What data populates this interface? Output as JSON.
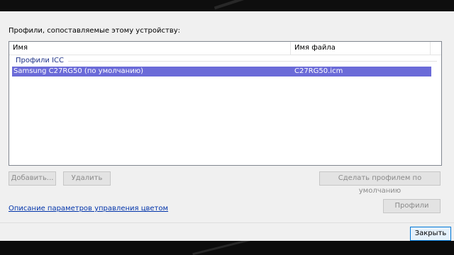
{
  "dialog": {
    "heading": "Профили, сопоставляемые этому устройству:"
  },
  "listview": {
    "columns": [
      "Имя",
      "Имя файла"
    ],
    "group_label": "Профили ICC",
    "rows": [
      {
        "name": "Samsung C27RG50 (по умолчанию)",
        "file": "C27RG50.icm",
        "selected": true
      }
    ]
  },
  "buttons": {
    "add": "Добавить...",
    "delete": "Удалить",
    "set_default": "Сделать профилем по умолчанию",
    "profiles": "Профили",
    "close": "Закрыть"
  },
  "link": {
    "color_settings": "Описание параметров управления цветом"
  },
  "colors": {
    "selection": "#6b6bd8",
    "link": "#0033aa",
    "group": "#1e3287"
  }
}
